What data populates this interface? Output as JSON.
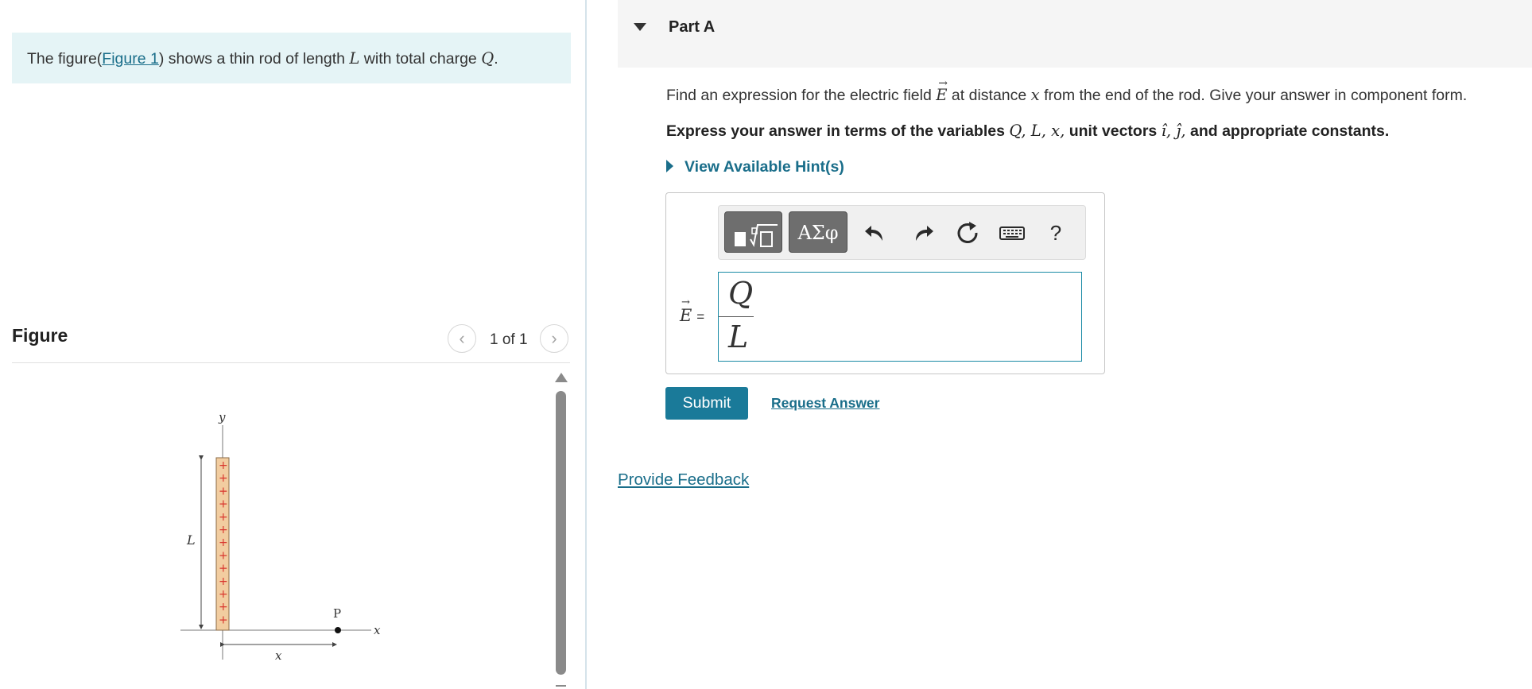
{
  "intro": {
    "prefix": "The figure(",
    "link": "Figure 1",
    "middle": ") shows a thin rod of length ",
    "var_L": "L",
    "middle2": " with total charge ",
    "var_Q": "Q",
    "suffix": "."
  },
  "figure": {
    "title": "Figure",
    "page_indicator": "1 of 1",
    "labels": {
      "y": "y",
      "L": "L",
      "P": "P",
      "x_axis": "x",
      "x_dist": "x"
    },
    "charge_sign": "+"
  },
  "part": {
    "title": "Part A",
    "question_a": "Find an expression for the electric field ",
    "question_E": "E",
    "question_b": " at distance ",
    "question_x": "x",
    "question_c": " from the end of the rod. Give your answer in component form.",
    "instr_a": "Express your answer in terms of the variables ",
    "instr_vars": "Q, L, x,",
    "instr_b": " unit vectors ",
    "instr_units": "î, ĵ,",
    "instr_c": " and appropriate constants.",
    "hint_label": "View Available Hint(s)"
  },
  "toolbar": {
    "symbols_label": "ΑΣφ",
    "help_label": "?"
  },
  "answer": {
    "lhs_var": "E",
    "equals": "=",
    "numerator": "Q",
    "denominator": "L"
  },
  "actions": {
    "submit": "Submit",
    "request": "Request Answer",
    "feedback": "Provide Feedback"
  }
}
